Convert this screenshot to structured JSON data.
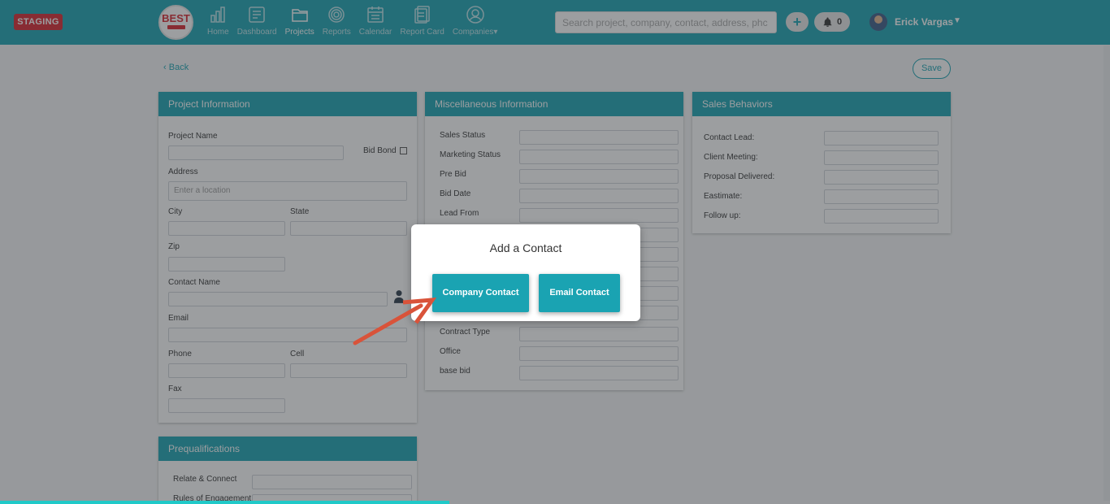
{
  "env_badge": "STAGING",
  "logo_text": "BEST",
  "nav": [
    {
      "label": "Home",
      "icon": "bar-chart-icon"
    },
    {
      "label": "Dashboard",
      "icon": "dashboard-icon"
    },
    {
      "label": "Projects",
      "icon": "folder-icon",
      "active": true
    },
    {
      "label": "Reports",
      "icon": "target-icon"
    },
    {
      "label": "Calendar",
      "icon": "calendar-icon"
    },
    {
      "label": "Report Card",
      "icon": "report-card-icon"
    },
    {
      "label": "Companies",
      "icon": "user-circle-icon",
      "caret": "▾"
    }
  ],
  "search": {
    "placeholder": "Search project, company, contact, address, phc"
  },
  "notifications": {
    "count": "0"
  },
  "user": {
    "name": "Erick Vargas",
    "caret": "▼"
  },
  "page": {
    "back_label": "Back",
    "save_label": "Save"
  },
  "project_info": {
    "title": "Project Information",
    "project_name": "Project Name",
    "bid_bond": "Bid Bond",
    "address": "Address",
    "address_placeholder": "Enter a location",
    "city": "City",
    "state": "State",
    "zip": "Zip",
    "contact_name": "Contact Name",
    "email": "Email",
    "phone": "Phone",
    "cell": "Cell",
    "fax": "Fax"
  },
  "prequalifications": {
    "title": "Prequalifications",
    "rows": [
      "Relate & Connect",
      "Rules of Engagement"
    ]
  },
  "misc_info": {
    "title": "Miscellaneous Information",
    "rows": [
      "Sales Status",
      "Marketing Status",
      "Pre Bid",
      "Bid Date",
      "Lead From",
      "",
      "",
      "",
      "",
      "",
      "Contract Type",
      "Office",
      "base bid"
    ]
  },
  "sales_behaviors": {
    "title": "Sales Behaviors",
    "rows": [
      "Contact Lead:",
      "Client Meeting:",
      "Proposal Delivered:",
      "Eastimate:",
      "Follow up:"
    ]
  },
  "modal": {
    "title": "Add a Contact",
    "company_contact": "Company Contact",
    "email_contact": "Email Contact"
  },
  "colors": {
    "primary": "#1aa3b2",
    "badge": "#d8262e",
    "arrow": "#d9533a"
  }
}
